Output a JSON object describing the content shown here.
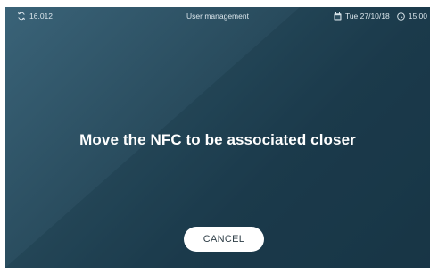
{
  "status_bar": {
    "sync_value": "16.012",
    "title": "User management",
    "date": "Tue 27/10/18",
    "time": "15:00",
    "sync_icon": "sync-icon",
    "calendar_icon": "calendar-icon",
    "clock_icon": "clock-icon"
  },
  "main": {
    "message": "Move the NFC to be associated closer",
    "cancel_label": "CANCEL"
  },
  "colors": {
    "background_light": "#3a6378",
    "background_dark": "#1b3849",
    "text": "#ffffff",
    "button_bg": "#ffffff",
    "button_text": "#2f3e47"
  }
}
